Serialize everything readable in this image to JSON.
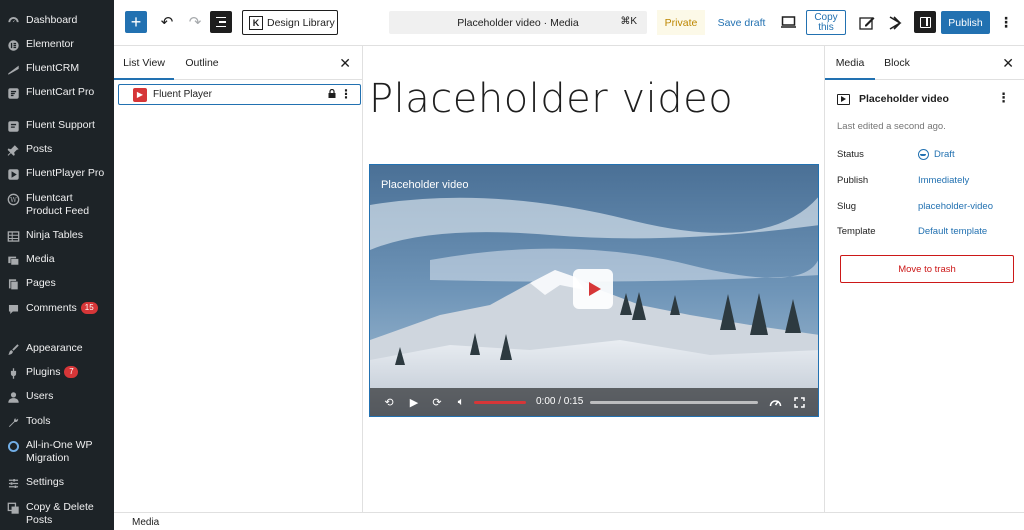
{
  "admin_menu": [
    {
      "label": "Dashboard",
      "icon": "dashboard-icon",
      "badge": ""
    },
    {
      "label": "Elementor",
      "icon": "elementor-icon",
      "badge": ""
    },
    {
      "label": "FluentCRM",
      "icon": "fluentcrm-icon",
      "badge": ""
    },
    {
      "label": "FluentCart Pro",
      "icon": "fluentcart-icon",
      "badge": ""
    },
    {
      "label": "Fluent Support",
      "icon": "fluent-support-icon",
      "badge": ""
    },
    {
      "label": "Posts",
      "icon": "pin-icon",
      "badge": ""
    },
    {
      "label": "FluentPlayer Pro",
      "icon": "fluentplayer-icon",
      "badge": ""
    },
    {
      "label": "Fluentcart\nProduct Feed",
      "icon": "wordpress-icon",
      "badge": ""
    },
    {
      "label": "Ninja Tables",
      "icon": "table-icon",
      "badge": ""
    },
    {
      "label": "Media",
      "icon": "media-icon",
      "badge": ""
    },
    {
      "label": "Pages",
      "icon": "page-icon",
      "badge": ""
    },
    {
      "label": "Comments",
      "icon": "comment-icon",
      "badge": "15"
    },
    {
      "label": "Appearance",
      "icon": "brush-icon",
      "badge": ""
    },
    {
      "label": "Plugins",
      "icon": "plugin-icon",
      "badge": "7"
    },
    {
      "label": "Users",
      "icon": "user-icon",
      "badge": ""
    },
    {
      "label": "Tools",
      "icon": "wrench-icon",
      "badge": ""
    },
    {
      "label": "All-in-One WP\nMigration",
      "icon": "migration-icon",
      "badge": ""
    },
    {
      "label": "Settings",
      "icon": "settings-icon",
      "badge": ""
    },
    {
      "label": "Copy & Delete\nPosts",
      "icon": "copy-icon",
      "badge": ""
    }
  ],
  "toolbar": {
    "inserter": "+",
    "design_library": "Design Library",
    "doc_title": "Placeholder video · Media",
    "shortcut": "⌘K",
    "private": "Private",
    "save_draft": "Save draft",
    "copy_this_line1": "Copy",
    "copy_this_line2": "this",
    "publish": "Publish"
  },
  "list_view": {
    "tabs": [
      "List View",
      "Outline"
    ],
    "active_tab": "List View",
    "row_label": "Fluent Player"
  },
  "canvas": {
    "title": "Placeholder video",
    "video_title": "Placeholder video",
    "time": "0:00 / 0:15"
  },
  "settings": {
    "tabs": [
      "Media",
      "Block"
    ],
    "doc_name": "Placeholder video",
    "last_edited": "Last edited a second ago.",
    "rows": [
      {
        "key": "Status",
        "value": "Draft"
      },
      {
        "key": "Publish",
        "value": "Immediately"
      },
      {
        "key": "Slug",
        "value": "placeholder-video"
      },
      {
        "key": "Template",
        "value": "Default template"
      }
    ],
    "trash": "Move to trash"
  },
  "footer": {
    "breadcrumb": "Media"
  },
  "colors": {
    "accent": "#2271b1",
    "admin_bg": "#1d2327",
    "danger": "#cc1818",
    "player_red": "#d63638"
  }
}
